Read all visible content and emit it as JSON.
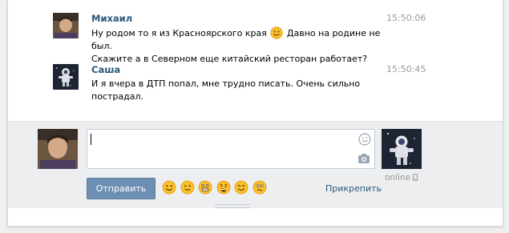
{
  "messages": [
    {
      "author": "Михаил",
      "time": "15:50:06",
      "line1_before": "Ну родом то я из Красноярского края",
      "line1_after": "Давно на родине не был.",
      "line2": "Скажите а в Северном еще китайский ресторан работает?",
      "inline_emoji": "smile-emoji-icon"
    },
    {
      "author": "Саша",
      "time": "15:50:45",
      "line1": "И я вчера в ДТП попал, мне трудно писать. Очень сильно пострадал."
    }
  ],
  "composer": {
    "input_value": "",
    "send_label": "Отправить",
    "attach_label": "Прикрепить",
    "peer_status": "online",
    "emoji_icons": [
      "smile-emoji-icon",
      "wink-emoji-icon",
      "grin-emoji-icon",
      "scared-emoji-icon",
      "happy-emoji-icon",
      "confused-emoji-icon"
    ]
  },
  "colors": {
    "accent": "#2b587a",
    "button": "#6d8fb3",
    "composer_bg": "#edeef0",
    "emoji_yellow": "#fbc02d"
  }
}
